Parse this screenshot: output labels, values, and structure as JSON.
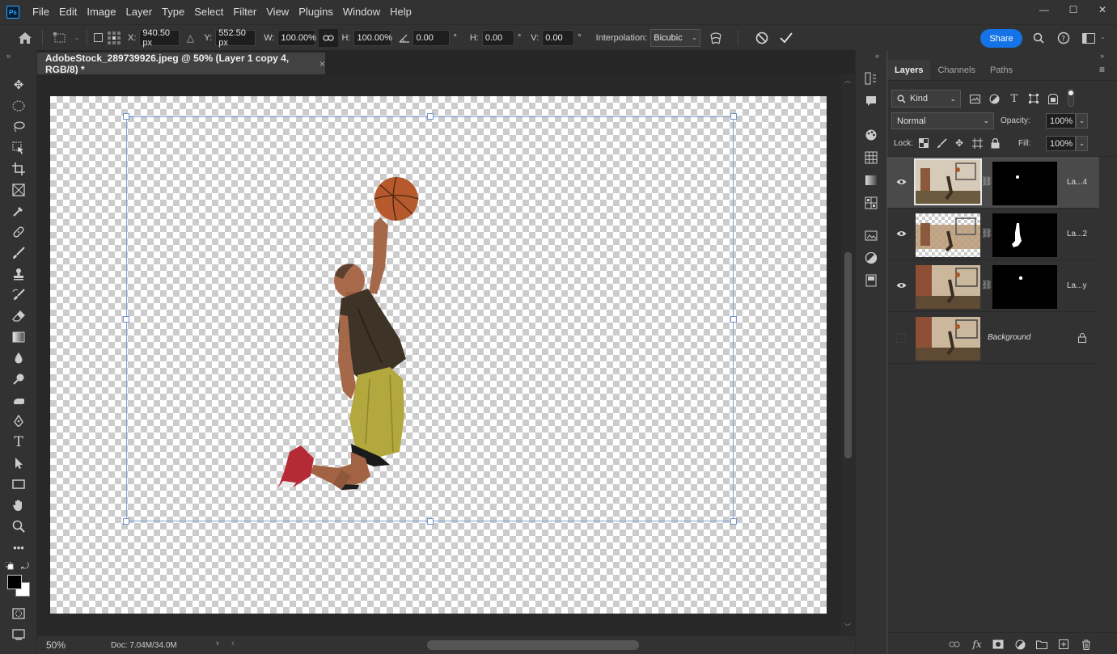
{
  "app": {
    "logo_text": "Ps"
  },
  "menu": [
    "File",
    "Edit",
    "Image",
    "Layer",
    "Type",
    "Select",
    "Filter",
    "View",
    "Plugins",
    "Window",
    "Help"
  ],
  "window_controls": {
    "minimize": "—",
    "maximize": "☐",
    "close": "✕"
  },
  "options": {
    "x_label": "X:",
    "x_value": "940.50 px",
    "y_label": "Y:",
    "y_value": "552.50 px",
    "w_label": "W:",
    "w_value": "100.00%",
    "h_label": "H:",
    "h_value": "100.00%",
    "angle_value": "0.00",
    "angle_unit": "°",
    "hskew_label": "H:",
    "hskew_value": "0.00",
    "hskew_unit": "°",
    "vskew_label": "V:",
    "vskew_value": "0.00",
    "vskew_unit": "°",
    "interp_label": "Interpolation:",
    "interp_value": "Bicubic",
    "share_label": "Share"
  },
  "document": {
    "tab_title": "AdobeStock_289739926.jpeg @ 50% (Layer 1 copy 4, RGB/8) *",
    "close_glyph": "×"
  },
  "status": {
    "zoom": "50%",
    "doc": "Doc: 7.04M/34.0M"
  },
  "layers_panel": {
    "tabs": [
      "Layers",
      "Channels",
      "Paths"
    ],
    "filter_kind": "Kind",
    "blend_mode": "Normal",
    "opacity_label": "Opacity:",
    "opacity_value": "100%",
    "lock_label": "Lock:",
    "fill_label": "Fill:",
    "fill_value": "100%",
    "layers": [
      {
        "name": "La...4"
      },
      {
        "name": "La...2"
      },
      {
        "name": "La...y"
      },
      {
        "name": "Background"
      }
    ]
  },
  "colors": {
    "accent": "#1473e6",
    "panel_bg": "#323232",
    "canvas_bg": "#282828",
    "transform_box": "#7da2d6"
  }
}
